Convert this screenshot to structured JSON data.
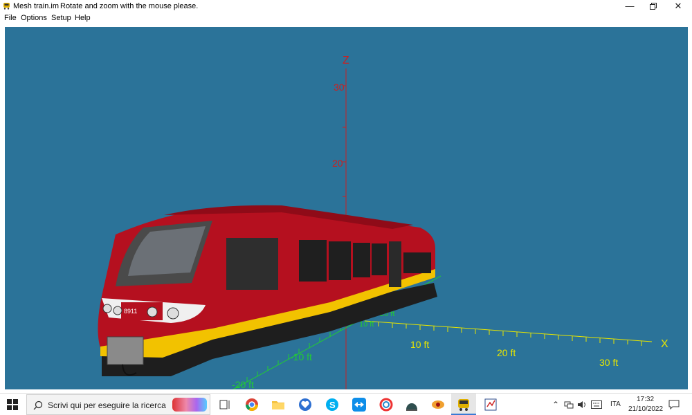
{
  "window": {
    "title": "Mesh train.im",
    "subtitle": "Rotate and zoom with the mouse please.",
    "controls": [
      "minimize",
      "restore",
      "close"
    ]
  },
  "menu": {
    "items": [
      "File",
      "Options",
      "Setup",
      "Help"
    ]
  },
  "viewport": {
    "background": "#2b7399",
    "z_axis": {
      "label": "Z",
      "ticks": [
        "20",
        "30"
      ],
      "color": "#cc1f1f"
    },
    "x_axis": {
      "label": "X",
      "ticks": [
        "10 ft",
        "20 ft",
        "30 ft"
      ],
      "color": "#e8e600"
    },
    "y_axis": {
      "ticks_near": [
        "10 ft",
        "20 ft"
      ],
      "ticks_far": [
        "-10 ft",
        "-20 ft"
      ],
      "color": "#22cc33"
    },
    "train": {
      "body_color": "#b5101f",
      "stripe_color": "#f2c200",
      "skirt_color": "#1e1e1e",
      "number": "8911"
    }
  },
  "taskbar": {
    "search_placeholder": "Scrivi qui per eseguire la ricerca",
    "language": "ITA",
    "time": "17:32",
    "date": "21/10/2022",
    "pinned": [
      "task-view-icon",
      "chrome-icon",
      "file-explorer-icon",
      "app-heart-icon",
      "skype-icon",
      "teamviewer-icon",
      "app-c-icon",
      "app-dome-icon",
      "app-eye-icon",
      "train-app-icon",
      "app-doc-icon"
    ]
  }
}
